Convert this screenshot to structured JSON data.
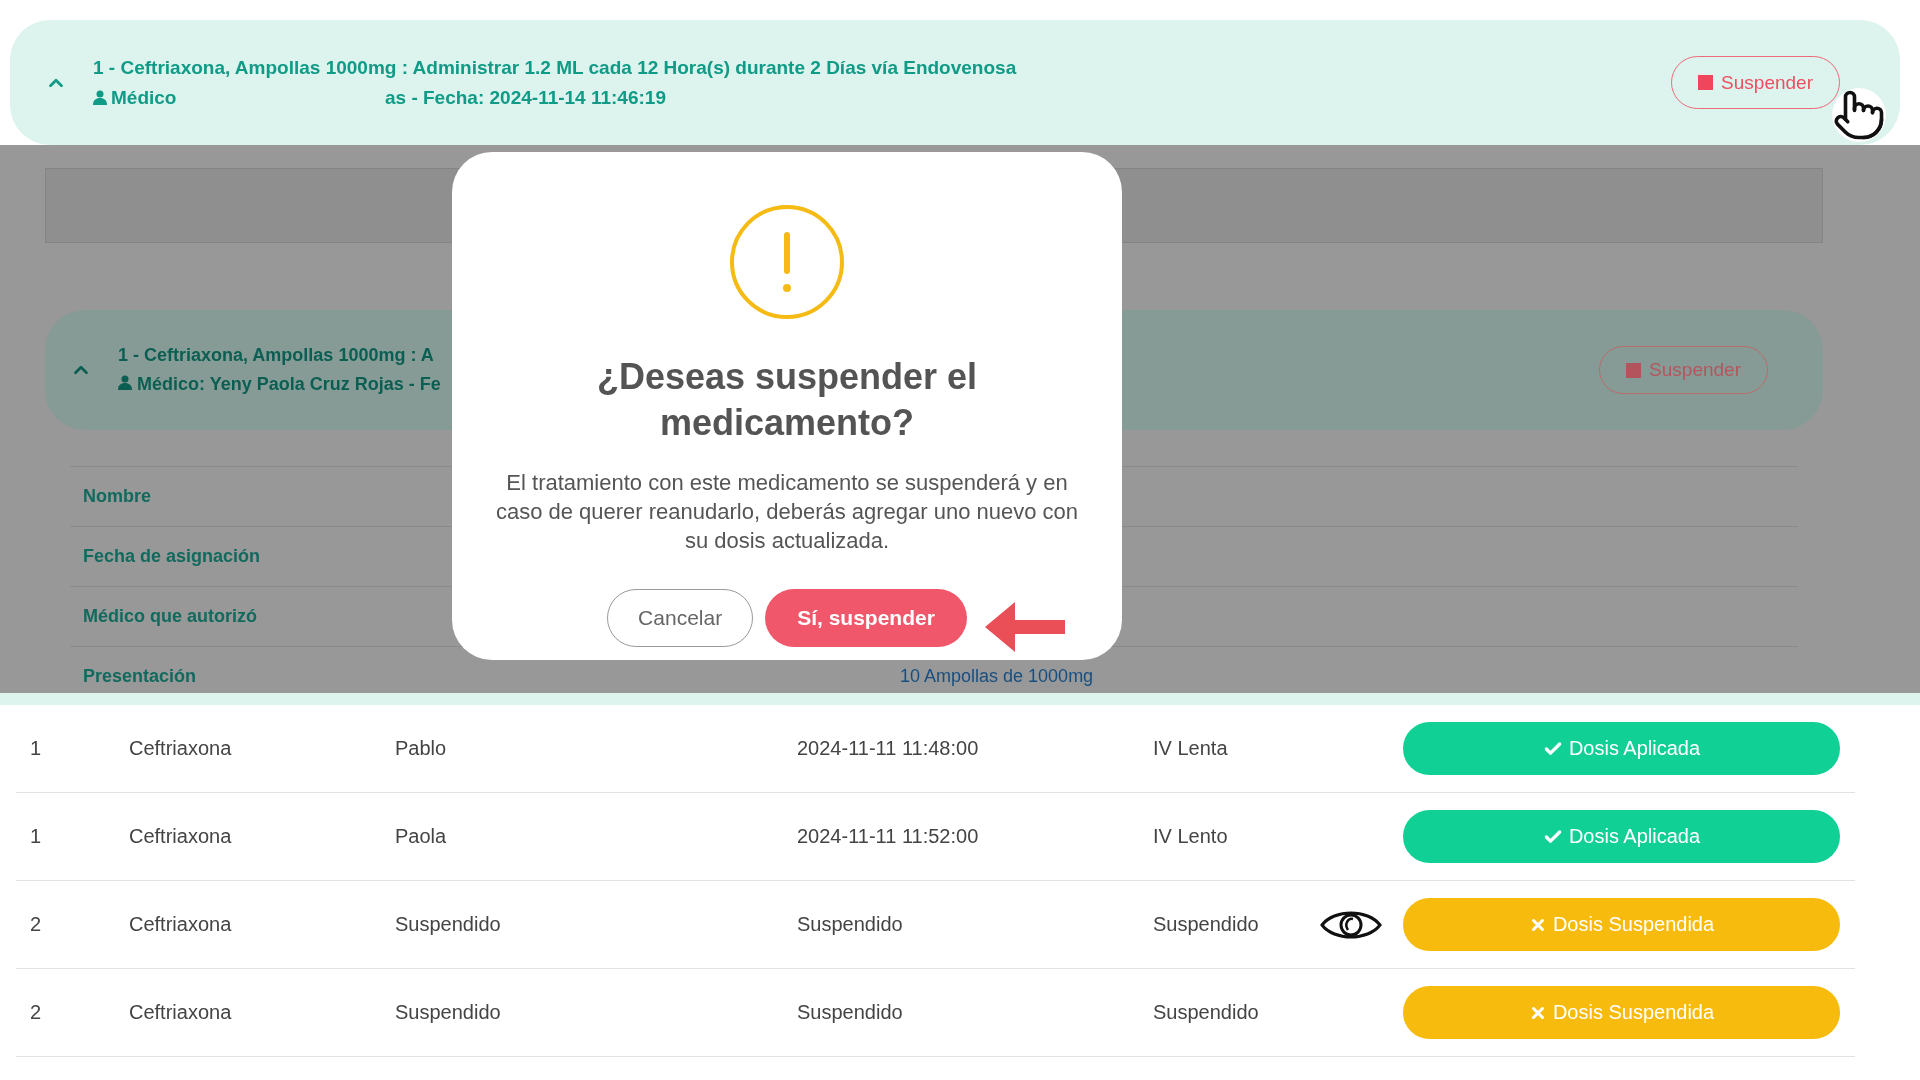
{
  "top_card": {
    "expanded": true,
    "title": "1 - Ceftriaxona, Ampollas 1000mg : Administrar 1.2 ML cada 12 Hora(s) durante 2 Días vía Endovenosa",
    "doctor_label": "Médico",
    "date_text": "as - Fecha: 2024-11-14 11:46:19",
    "button": "Suspender"
  },
  "background": {
    "card": {
      "expanded": true,
      "title": "1 - Ceftriaxona, Ampollas 1000mg : A",
      "doctor": "Médico: Yeny Paola Cruz Rojas - Fe",
      "button": "Suspender"
    },
    "details": [
      {
        "label": "Nombre"
      },
      {
        "label": "Fecha de asignación"
      },
      {
        "label": "Médico que autorizó"
      },
      {
        "label": "Presentación",
        "value": "10 Ampollas de 1000mg"
      }
    ]
  },
  "dialog": {
    "title": "¿Deseas suspender el medicamento?",
    "message": "El tratamiento con este medicamento se suspenderá y en caso de querer reanudarlo, deberás agregar uno nuevo con su dosis actualizada.",
    "buttons": [
      {
        "label": "Cancelar",
        "kind": "secondary"
      },
      {
        "label": "Sí, suspender",
        "kind": "danger"
      }
    ]
  },
  "doses": [
    {
      "number": "1",
      "drug": "Ceftriaxona",
      "nurse": "Pablo",
      "time": "2024-11-11 11:48:00",
      "route": "IV Lenta",
      "viewable": false,
      "kind": "applied",
      "status_label": "Dosis Aplicada"
    },
    {
      "number": "1",
      "drug": "Ceftriaxona",
      "nurse": "Paola",
      "time": "2024-11-11 11:52:00",
      "route": "IV Lento",
      "viewable": false,
      "kind": "applied",
      "status_label": "Dosis Aplicada"
    },
    {
      "number": "2",
      "drug": "Ceftriaxona",
      "nurse": "Suspendido",
      "time": "Suspendido",
      "route": "Suspendido",
      "viewable": true,
      "kind": "suspended",
      "status_label": "Dosis Suspendida"
    },
    {
      "number": "2",
      "drug": "Ceftriaxona",
      "nurse": "Suspendido",
      "time": "Suspendido",
      "route": "Suspendido",
      "viewable": false,
      "kind": "suspended",
      "status_label": "Dosis Suspendida"
    }
  ]
}
